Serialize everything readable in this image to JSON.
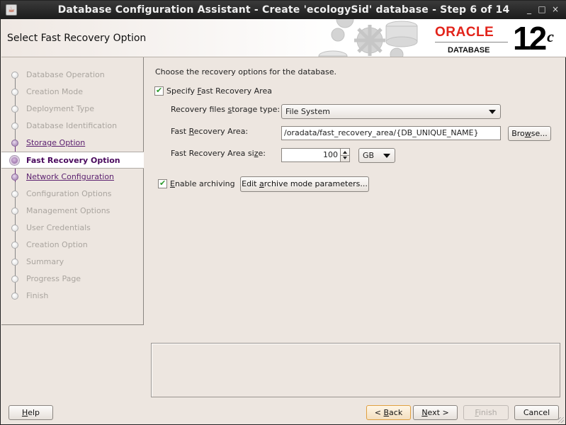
{
  "window": {
    "title": "Database Configuration Assistant - Create 'ecologySid' database - Step 6 of 14",
    "controls": {
      "minimize": "_",
      "maximize": "□",
      "close": "×"
    }
  },
  "header": {
    "page_title": "Select Fast Recovery Option",
    "logo": {
      "brand": "ORACLE",
      "product": "DATABASE",
      "version": "12",
      "version_suffix": "c"
    }
  },
  "sidebar": {
    "steps": [
      {
        "label": "Database Operation",
        "state": "done"
      },
      {
        "label": "Creation Mode",
        "state": "done"
      },
      {
        "label": "Deployment Type",
        "state": "done"
      },
      {
        "label": "Database Identification",
        "state": "done"
      },
      {
        "label": "Storage Option",
        "state": "link"
      },
      {
        "label": "Fast Recovery Option",
        "state": "current"
      },
      {
        "label": "Network Configuration",
        "state": "link"
      },
      {
        "label": "Configuration Options",
        "state": "pending"
      },
      {
        "label": "Management Options",
        "state": "pending"
      },
      {
        "label": "User Credentials",
        "state": "pending"
      },
      {
        "label": "Creation Option",
        "state": "pending"
      },
      {
        "label": "Summary",
        "state": "pending"
      },
      {
        "label": "Progress Page",
        "state": "pending"
      },
      {
        "label": "Finish",
        "state": "pending"
      }
    ]
  },
  "main": {
    "intro": "Choose the recovery options for the database.",
    "specify_fra": {
      "pre": "Specify ",
      "mnemonic": "F",
      "post": "ast Recovery Area",
      "checked": true
    },
    "storage_type": {
      "pre": "Recovery files ",
      "mnemonic": "s",
      "post": "torage type:",
      "value": "File System"
    },
    "fra_location": {
      "pre": "Fast ",
      "mnemonic": "R",
      "post": "ecovery Area:",
      "value": "/oradata/fast_recovery_area/{DB_UNIQUE_NAME}"
    },
    "browse": {
      "pre": "Bro",
      "mnemonic": "w",
      "post": "se..."
    },
    "fra_size": {
      "pre": "Fast Recovery Area si",
      "mnemonic": "z",
      "post": "e:",
      "value": "100",
      "unit": "GB"
    },
    "enable_archiving": {
      "pre": "",
      "mnemonic": "E",
      "post": "nable archiving",
      "checked": true
    },
    "edit_archive": {
      "pre": "Edit ",
      "mnemonic": "a",
      "post": "rchive mode parameters..."
    }
  },
  "footer": {
    "help": {
      "pre": "",
      "mnemonic": "H",
      "post": "elp"
    },
    "back": {
      "pre": "< ",
      "mnemonic": "B",
      "post": "ack"
    },
    "next": {
      "pre": "",
      "mnemonic": "N",
      "post": "ext >"
    },
    "finish": {
      "pre": "",
      "mnemonic": "F",
      "post": "inish"
    },
    "cancel": {
      "label": "Cancel"
    }
  }
}
